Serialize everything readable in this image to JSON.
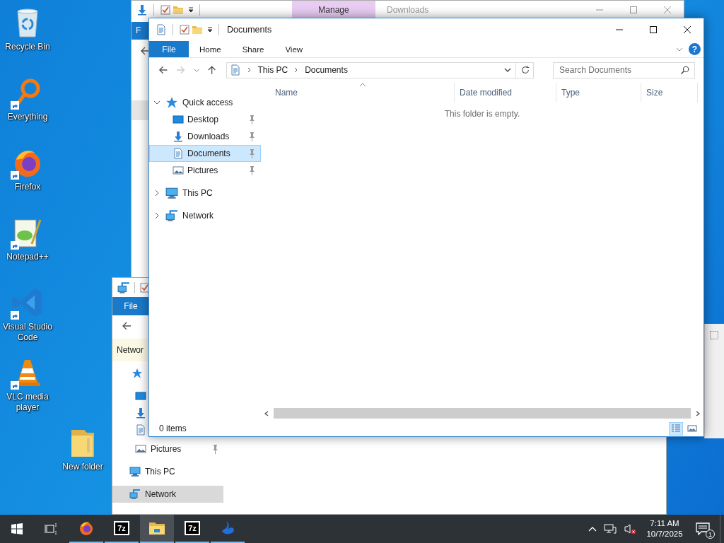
{
  "desktop_icons": [
    {
      "label": "Recycle Bin",
      "kind": "recycle",
      "shortcut": false
    },
    {
      "label": "Everything",
      "kind": "everything",
      "shortcut": true
    },
    {
      "label": "Firefox",
      "kind": "firefox",
      "shortcut": true
    },
    {
      "label": "Notepad++",
      "kind": "notepad",
      "shortcut": true
    },
    {
      "label": "Visual Studio Code",
      "kind": "vscode",
      "shortcut": true
    },
    {
      "label": "VLC media player",
      "kind": "vlc",
      "shortcut": true
    },
    {
      "label": "New folder",
      "kind": "folder",
      "shortcut": false
    }
  ],
  "back_window": {
    "title": "Downloads",
    "context_tab": "Manage",
    "file_tab": "F"
  },
  "network_window": {
    "file_tab": "File",
    "address": "Networ",
    "nav_items": [
      {
        "label": "Pictures",
        "kind": "picture",
        "pinned": true,
        "selected": false
      },
      {
        "label": "This PC",
        "kind": "pc",
        "pinned": false,
        "selected": false
      },
      {
        "label": "Network",
        "kind": "network",
        "pinned": false,
        "selected": true
      }
    ]
  },
  "main_window": {
    "title": "Documents",
    "file_tab": "File",
    "ribbon_tabs": [
      "Home",
      "Share",
      "View"
    ],
    "help_label": "?",
    "forward_disabled": true,
    "breadcrumbs": [
      "This PC",
      "Documents"
    ],
    "search": {
      "placeholder": "Search Documents"
    },
    "nav_tree": [
      {
        "label": "Quick access",
        "kind": "star",
        "expanded": true,
        "selected": false,
        "children": [
          {
            "label": "Desktop",
            "kind": "desktop",
            "pinned": true,
            "selected": false
          },
          {
            "label": "Downloads",
            "kind": "download",
            "pinned": true,
            "selected": false
          },
          {
            "label": "Documents",
            "kind": "doc",
            "pinned": true,
            "selected": true
          },
          {
            "label": "Pictures",
            "kind": "picture",
            "pinned": true,
            "selected": false
          }
        ]
      },
      {
        "label": "This PC",
        "kind": "pc",
        "expanded": false,
        "selected": false
      },
      {
        "label": "Network",
        "kind": "network",
        "expanded": false,
        "selected": false
      }
    ],
    "columns": [
      {
        "label": "Name",
        "sorted": true
      },
      {
        "label": "Date modified",
        "sorted": false
      },
      {
        "label": "Type",
        "sorted": false
      },
      {
        "label": "Size",
        "sorted": false
      }
    ],
    "empty_message": "This folder is empty.",
    "status_text": "0 items",
    "view_buttons": [
      {
        "kind": "details",
        "selected": true
      },
      {
        "kind": "large",
        "selected": false
      }
    ]
  },
  "taskbar": {
    "apps": [
      {
        "kind": "firefox",
        "active": false
      },
      {
        "kind": "archive",
        "logo_text": "7z",
        "active": false
      },
      {
        "kind": "explorer",
        "active": true
      },
      {
        "kind": "archive",
        "logo_text": "7z",
        "active": false
      },
      {
        "kind": "bird",
        "active": false
      }
    ],
    "time": "7:11 AM",
    "date": "10/7/2025",
    "volume_muted": true,
    "notification_count": "1"
  }
}
